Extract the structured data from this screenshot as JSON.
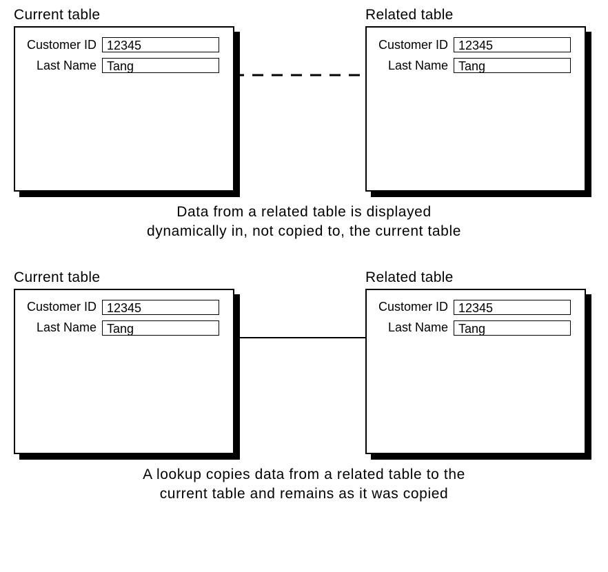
{
  "section1": {
    "left": {
      "title": "Current table",
      "customerLabel": "Customer ID",
      "customerValue": "12345",
      "lastNameLabel": "Last Name",
      "lastNameValue": "Tang"
    },
    "right": {
      "title": "Related table",
      "customerLabel": "Customer ID",
      "customerValue": "12345",
      "lastNameLabel": "Last Name",
      "lastNameValue": "Tang"
    },
    "caption": "Data from a related table is displayed\ndynamically in, not copied to, the current table"
  },
  "section2": {
    "left": {
      "title": "Current table",
      "customerLabel": "Customer ID",
      "customerValue": "12345",
      "lastNameLabel": "Last Name",
      "lastNameValue": "Tang"
    },
    "right": {
      "title": "Related table",
      "customerLabel": "Customer ID",
      "customerValue": "12345",
      "lastNameLabel": "Last Name",
      "lastNameValue": "Tang"
    },
    "caption": "A lookup copies data from a related table to the\ncurrent table and remains as it was copied"
  }
}
